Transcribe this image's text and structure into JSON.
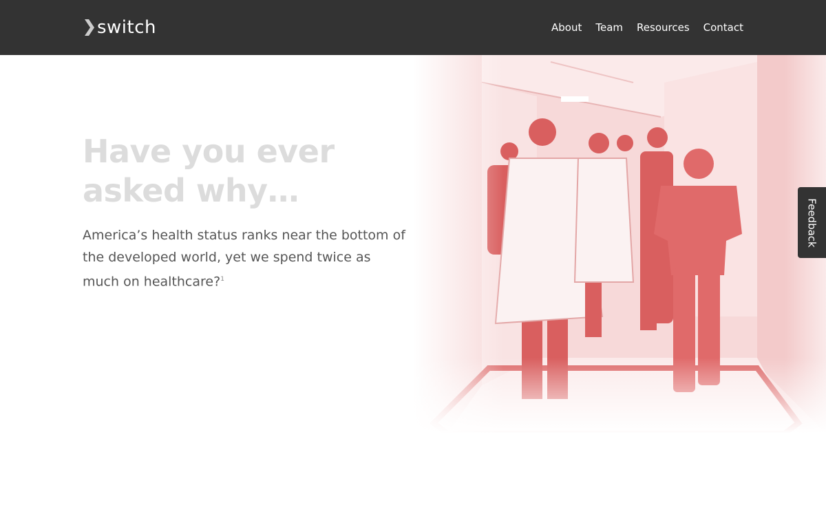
{
  "header": {
    "logo_text": "switch",
    "nav": [
      {
        "label": "About"
      },
      {
        "label": "Team"
      },
      {
        "label": "Resources"
      },
      {
        "label": "Contact"
      }
    ]
  },
  "hero": {
    "headline": "Have you ever asked why…",
    "body": "America’s health status ranks near the bottom of the developed world, yet we spend twice as much on healthcare?",
    "footnote": "1"
  },
  "feedback_label": "Feedback",
  "colors": {
    "header_bg": "#333333",
    "image_tint": "#e06a6a",
    "headline": "#dcdcdc",
    "body_text": "#555555"
  }
}
